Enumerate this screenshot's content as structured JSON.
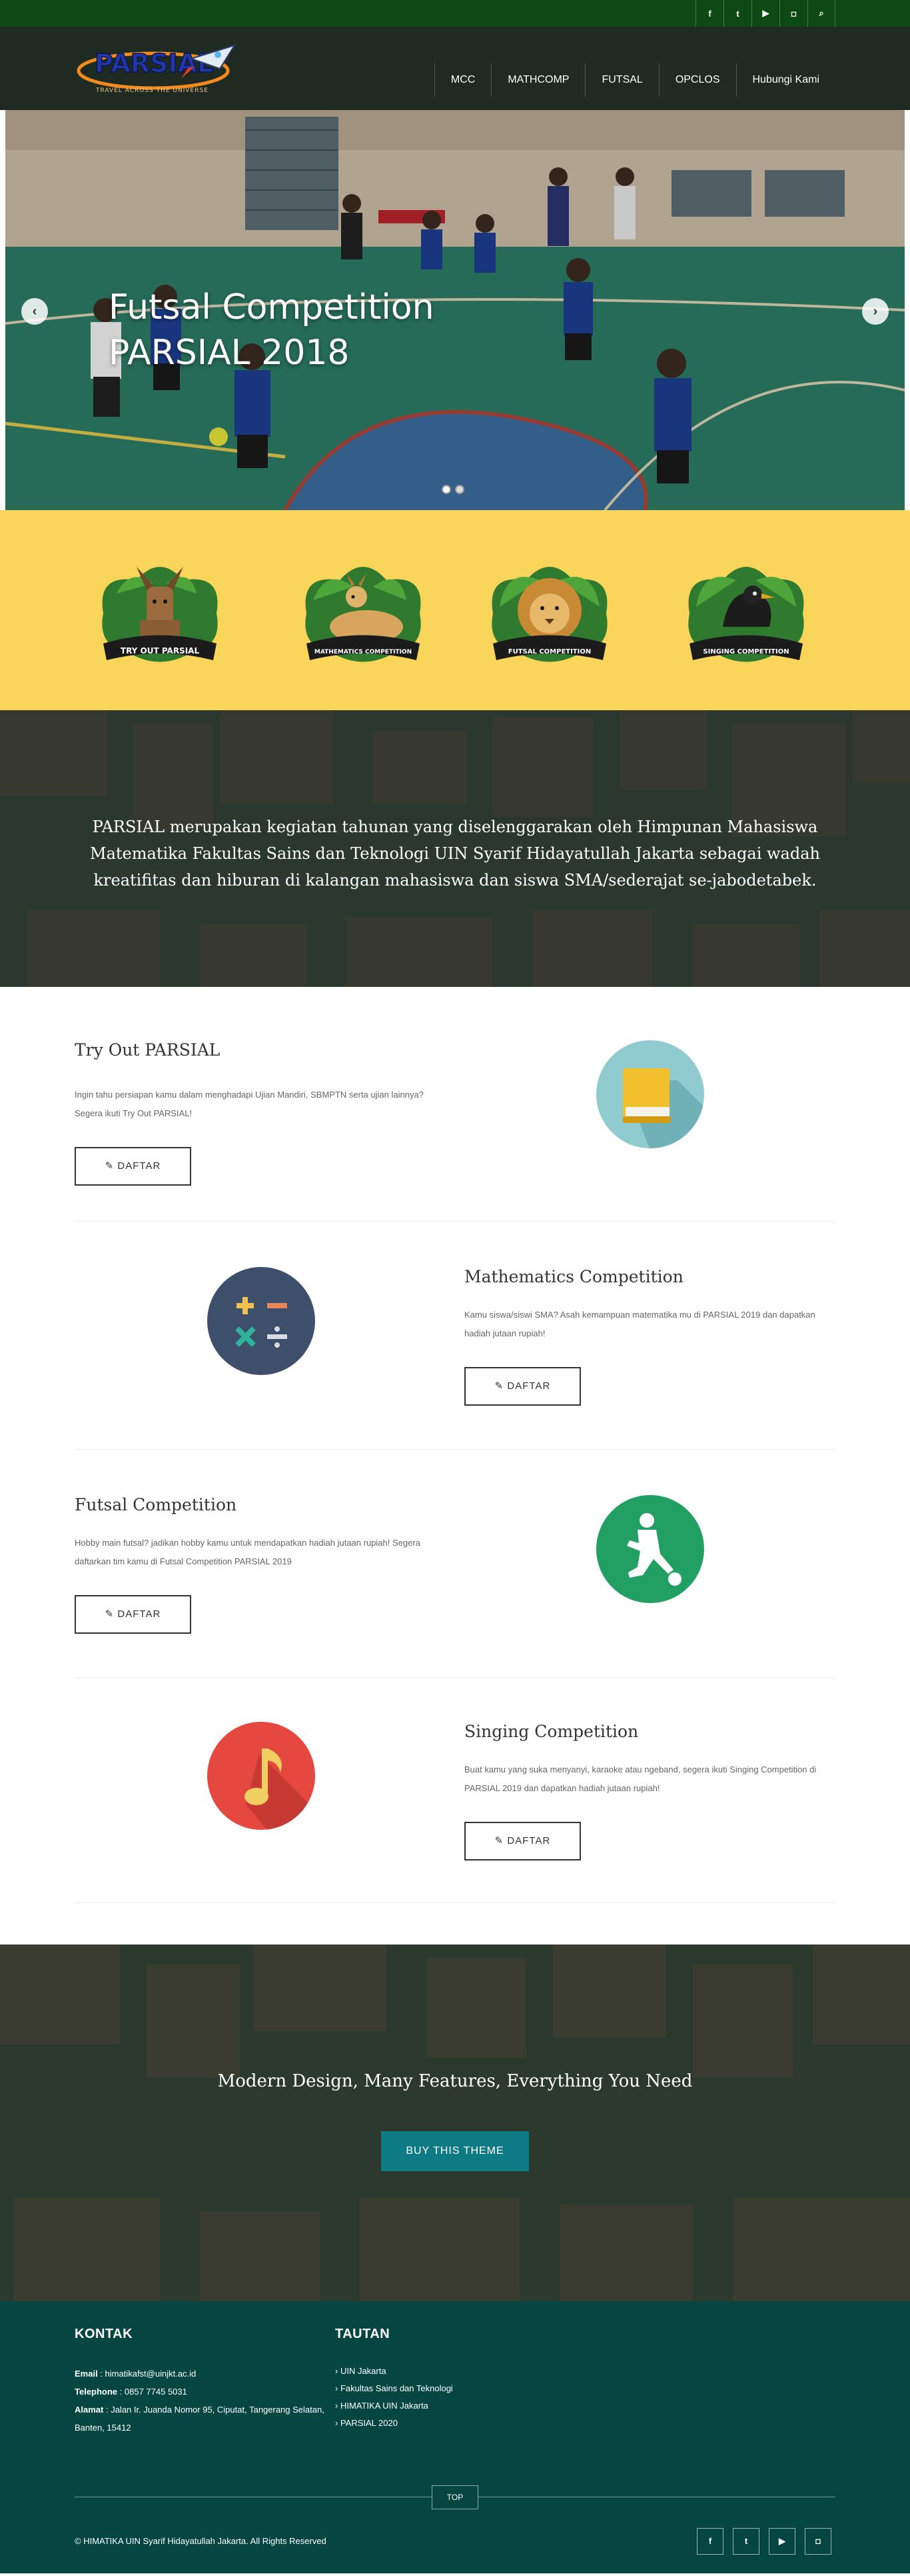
{
  "topbar": {
    "social": [
      {
        "icon": "facebook-icon",
        "glyph": "f"
      },
      {
        "icon": "twitter-icon",
        "glyph": "t"
      },
      {
        "icon": "youtube-icon",
        "glyph": "▶"
      },
      {
        "icon": "instagram-icon",
        "glyph": "◘"
      },
      {
        "icon": "search-icon",
        "glyph": "⌕"
      }
    ]
  },
  "header": {
    "logo_text": "PARSIAL",
    "logo_tagline": "TRAVEL ACROSS THE UNIVERSE",
    "nav": [
      "MCC",
      "MATHCOMP",
      "FUTSAL",
      "OPCLOS",
      "Hubungi Kami"
    ]
  },
  "hero": {
    "caption_line1": "Futsal Competition",
    "caption_line2": "PARSIAL 2018",
    "prev": "‹",
    "next": "›"
  },
  "events": [
    {
      "name": "Try Out Parsial",
      "badge_text": "TRY OUT PARSIAL"
    },
    {
      "name": "Mathematics Competition",
      "badge_text": "MATHEMATICS COMPETITION"
    },
    {
      "name": "Futsal Competition",
      "badge_text": "FUTSAL COMPETITION"
    },
    {
      "name": "Singing Competition",
      "badge_text": "SINGING COMPETITION"
    }
  ],
  "about": {
    "text": "PARSIAL merupakan kegiatan tahunan yang diselenggarakan oleh Himpunan Mahasiswa Matematika Fakultas Sains dan Teknologi UIN Syarif Hidayatullah Jakarta sebagai wadah kreatifitas dan hiburan di kalangan mahasiswa dan siswa SMA/sederajat se-jabodetabek."
  },
  "competitions": [
    {
      "title": "Try Out PARSIAL",
      "desc": "Ingin tahu persiapan kamu dalam menghadapi Ujian Mandiri, SBMPTN serta ujian lainnya? Segera ikuti Try Out PARSIAL!",
      "button": "DAFTAR",
      "icon": "book-icon",
      "color": "#8fcbcf"
    },
    {
      "title": "Mathematics Competition",
      "desc": "Kamu siswa/siswi SMA? Asah kemampuan matematika mu di PARSIAL 2019 dan dapatkan hadiah jutaan rupiah!",
      "button": "DAFTAR",
      "icon": "calculator-icon",
      "color": "#3e4f6b"
    },
    {
      "title": "Futsal Competition",
      "desc": "Hobby main futsal? jadikan hobby kamu untuk mendapatkan hadiah jutaan rupiah! Segera daftarkan tim kamu di Futsal Competition PARSIAL 2019",
      "button": "DAFTAR",
      "icon": "soccer-player-icon",
      "color": "#22a064"
    },
    {
      "title": "Singing Competition",
      "desc": "Buat kamu yang suka menyanyi, karaoke atau ngeband, segera ikuti Singing Competition di PARSIAL 2019 dan dapatkan hadiah jutaan rupiah!",
      "button": "DAFTAR",
      "icon": "music-note-icon",
      "color": "#e5483e"
    }
  ],
  "cta": {
    "heading": "Modern Design, Many Features, Everything You Need",
    "button": "BUY THIS THEME"
  },
  "footer": {
    "kontak_title": "KONTAK",
    "email_label": "Email",
    "email": "himatikafst@uinjkt.ac.id",
    "phone_label": "Telephone",
    "phone": "0857 7745 5031",
    "address_label": "Alamat",
    "address": "Jalan Ir. Juanda Nomor 95, Ciputat, Tangerang Selatan, Banten, 15412",
    "tautan_title": "TAUTAN",
    "links": [
      "UIN Jakarta",
      "Fakultas Sains dan Teknologi",
      "HIMATIKA UIN Jakarta",
      "PARSIAL 2020"
    ],
    "top": "TOP",
    "copyright": "© HIMATIKA UIN Syarif Hidayatullah Jakarta. All Rights Reserved"
  }
}
